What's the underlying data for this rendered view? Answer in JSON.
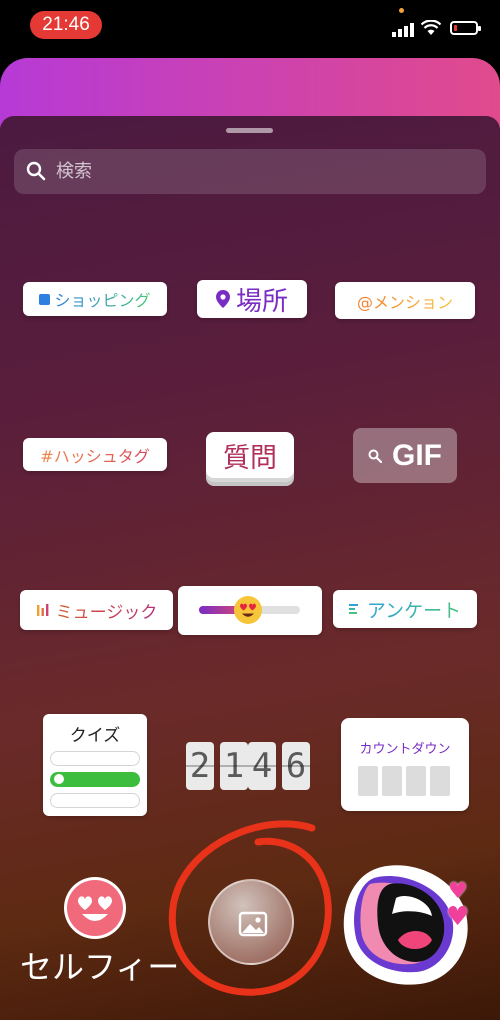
{
  "status_bar": {
    "time": "21:46"
  },
  "search": {
    "placeholder": "検索"
  },
  "stickers": {
    "shopping": "ショッピング",
    "location": "場所",
    "mention": "@メンション",
    "hashtag": "#ハッシュタグ",
    "question": "質問",
    "gif": "GIF",
    "music": "ミュージック",
    "poll": "アンケート",
    "quiz": "クイズ",
    "countdown": "カウントダウン",
    "clock_digits": [
      "2",
      "1",
      "4",
      "6"
    ],
    "emoji_slider_level": 0.5
  },
  "bottom": {
    "selfie_label": "セルフィー"
  },
  "colors": {
    "story_gradient": [
      "#b63ad6",
      "#e14a8c"
    ],
    "time_pill": "#e53935",
    "annotation_circle": "#e8321a"
  },
  "icons": {
    "search": "search-icon",
    "location": "map-pin-icon",
    "gif": "magnifier-icon",
    "photo": "image-icon"
  }
}
